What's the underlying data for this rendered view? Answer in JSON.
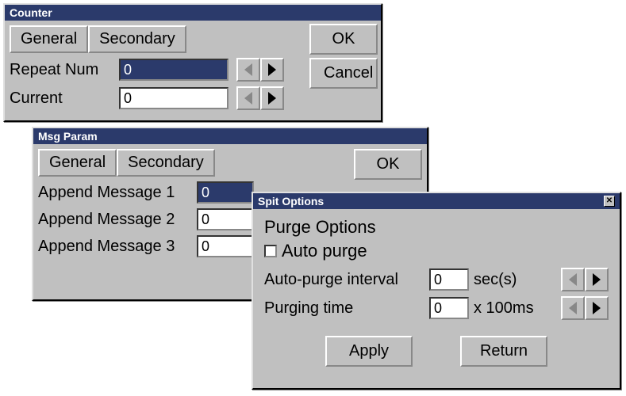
{
  "counter": {
    "title": "Counter",
    "tabs": {
      "general": "General",
      "secondary": "Secondary"
    },
    "rows": {
      "repeat_label": "Repeat Num",
      "repeat_value": "0",
      "current_label": "Current",
      "current_value": "0"
    },
    "buttons": {
      "ok": "OK",
      "cancel": "Cancel"
    }
  },
  "msgparam": {
    "title": "Msg Param",
    "tabs": {
      "general": "General",
      "secondary": "Secondary"
    },
    "rows": {
      "m1_label": "Append Message 1",
      "m1_value": "0",
      "m2_label": "Append Message 2",
      "m2_value": "0",
      "m3_label": "Append Message 3",
      "m3_value": "0"
    },
    "buttons": {
      "ok": "OK"
    }
  },
  "spit": {
    "title": "Spit Options",
    "section": "Purge Options",
    "auto_purge_label": "Auto purge",
    "interval_label": "Auto-purge interval",
    "interval_value": "0",
    "interval_unit": "sec(s)",
    "ptime_label": "Purging time",
    "ptime_value": "0",
    "ptime_unit": "x 100ms",
    "buttons": {
      "apply": "Apply",
      "return": "Return"
    }
  }
}
